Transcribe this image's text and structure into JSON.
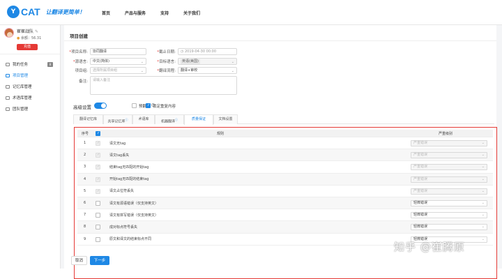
{
  "brand": {
    "logo_mark": "Y",
    "logo_text": "CAT",
    "slogan": "让翻译更简单！"
  },
  "nav": [
    "首页",
    "产品与服务",
    "支持",
    "关于我们"
  ],
  "profile": {
    "name": "崔崔战队",
    "balance": "余额：56.31",
    "recharge": "充值"
  },
  "sidebar": [
    {
      "label": "我的任务",
      "badge": "8"
    },
    {
      "label": "项目管理"
    },
    {
      "label": "记忆库管理"
    },
    {
      "label": "术语库管理"
    },
    {
      "label": "团队管理"
    }
  ],
  "page_title": "项目创建",
  "form": {
    "project_name_label": "项目名称:",
    "project_name_value": "协同翻译",
    "deadline_label": "截止日期:",
    "deadline_value": "2019-04-30 00:00",
    "source_lang_label": "源语言:",
    "source_lang_value": "中文(简体)",
    "target_lang_label": "目标语言:",
    "target_lang_tag": "英语(美国)",
    "project_group_label": "项目组:",
    "project_group_placeholder": "选择所属项目组",
    "workflow_label": "翻译流程:",
    "workflow_value": "翻译+审校",
    "remarks_label": "备注:",
    "remarks_placeholder": "请输入备注"
  },
  "advanced": {
    "label": "高级设置",
    "pretranslate_label": "预翻译",
    "lock_repeat_label": "锁定重复内容"
  },
  "tabs": [
    "翻译记忆库",
    "共享记忆库",
    "术语库",
    "机器翻译",
    "质量保证",
    "文档设置"
  ],
  "table": {
    "headers": [
      "序号",
      "",
      "规则",
      "严重级别"
    ],
    "rows": [
      {
        "no": "1",
        "rule": "译文无tag",
        "level": "严重错误",
        "disabled": true,
        "checked": true
      },
      {
        "no": "2",
        "rule": "译文tag丢失",
        "level": "严重错误",
        "disabled": true,
        "checked": true
      },
      {
        "no": "3",
        "rule": "结束tag无匹配的开始tag",
        "level": "严重错误",
        "disabled": true,
        "checked": true
      },
      {
        "no": "4",
        "rule": "开始tag无匹配的结束tag",
        "level": "严重错误",
        "disabled": true,
        "checked": true
      },
      {
        "no": "5",
        "rule": "译文占位符丢失",
        "level": "严重错误",
        "disabled": true,
        "checked": true
      },
      {
        "no": "6",
        "rule": "译文有源语错误（仅支持英文）",
        "level": "轻微错误",
        "disabled": false,
        "checked": false
      },
      {
        "no": "7",
        "rule": "译文有拼写错误（仅支持英文）",
        "level": "轻微错误",
        "disabled": false,
        "checked": false
      },
      {
        "no": "8",
        "rule": "成对标点符号丢失",
        "level": "轻微错误",
        "disabled": false,
        "checked": false
      },
      {
        "no": "9",
        "rule": "原文和译文的结束标点不同",
        "level": "轻微错误",
        "disabled": false,
        "checked": false
      }
    ]
  },
  "buttons": {
    "cancel": "取消",
    "next": "下一步"
  },
  "watermark": "知乎 @崔腾原",
  "colors": {
    "accent": "#1e88e5",
    "danger": "#e53935"
  }
}
